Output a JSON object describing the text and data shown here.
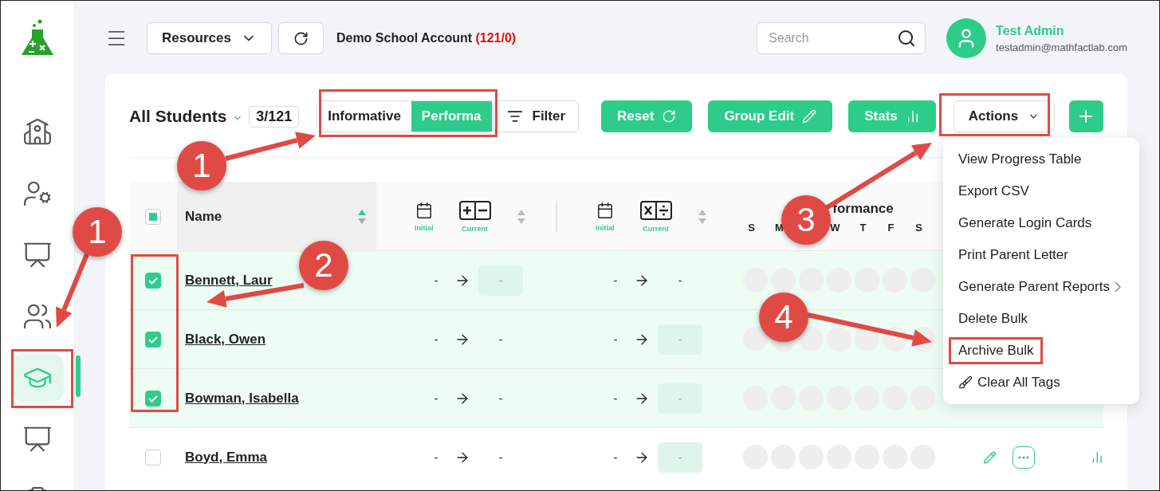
{
  "sidebar": {
    "items": [
      {
        "kind": "school",
        "selected": false
      },
      {
        "kind": "admin",
        "selected": false
      },
      {
        "kind": "classroom",
        "selected": false
      },
      {
        "kind": "group",
        "selected": false
      },
      {
        "kind": "student",
        "selected": true
      },
      {
        "kind": "teacher",
        "selected": false
      },
      {
        "kind": "board",
        "selected": false
      }
    ]
  },
  "header": {
    "resources": "Resources",
    "account_name": "Demo School Account",
    "account_count": "(121/0)",
    "search_placeholder": "Search",
    "user_name": "Test Admin",
    "user_email": "testadmin@mathfactlab.com"
  },
  "toolbar": {
    "title": "All Students",
    "count": "3/121",
    "views": [
      {
        "label": "Informative",
        "selected": false
      },
      {
        "label": "Performa",
        "selected": true
      }
    ],
    "filter": "Filter",
    "buttons": [
      {
        "label": "Reset",
        "kind": "reset"
      },
      {
        "label": "Group Edit",
        "kind": "edit"
      },
      {
        "label": "Stats",
        "kind": "stats"
      }
    ],
    "actions": "Actions"
  },
  "menu": {
    "items": [
      {
        "label": "View Progress Table",
        "kind": "plain"
      },
      {
        "label": "Export CSV",
        "kind": "plain"
      },
      {
        "label": "Generate Login Cards",
        "kind": "plain"
      },
      {
        "label": "Print Parent Letter",
        "kind": "plain"
      },
      {
        "label": "Generate Parent Reports",
        "kind": "submenu"
      },
      {
        "label": "Delete Bulk",
        "kind": "plain"
      },
      {
        "label": "Archive Bulk",
        "kind": "plain",
        "framed": true
      },
      {
        "label": "Clear All Tags",
        "kind": "tags"
      }
    ]
  },
  "table": {
    "select_all_partial": true,
    "name_header": "Name",
    "groups": [
      {
        "kind": "addsub",
        "initial": "Initial",
        "current": "Current"
      },
      {
        "kind": "muldiv",
        "initial": "Initial",
        "current": "Current"
      }
    ],
    "performance": "formance",
    "days": [
      "S",
      "M",
      "W",
      "T",
      "F",
      "S"
    ],
    "rows": [
      {
        "name": "Bennett, Laur",
        "checked": true,
        "tools": false,
        "cells": [
          {
            "initial": "-",
            "current": "-",
            "highlight": true
          },
          {
            "initial": "-",
            "current": "-",
            "highlight": false
          }
        ]
      },
      {
        "name": "Black, Owen",
        "checked": true,
        "tools": false,
        "cells": [
          {
            "initial": "-",
            "current": "-",
            "highlight": false
          },
          {
            "initial": "-",
            "current": "-",
            "highlight": true
          }
        ]
      },
      {
        "name": "Bowman, Isabella",
        "checked": true,
        "tools": false,
        "cells": [
          {
            "initial": "-",
            "current": "-",
            "highlight": false
          },
          {
            "initial": "-",
            "current": "-",
            "highlight": true
          }
        ]
      },
      {
        "name": "Boyd, Emma",
        "checked": false,
        "tools": true,
        "cells": [
          {
            "initial": "-",
            "current": "-",
            "highlight": false
          },
          {
            "initial": "-",
            "current": "-",
            "highlight": true
          }
        ]
      }
    ]
  },
  "annotations": {
    "badges": [
      "1",
      "1",
      "2",
      "3",
      "4"
    ]
  }
}
